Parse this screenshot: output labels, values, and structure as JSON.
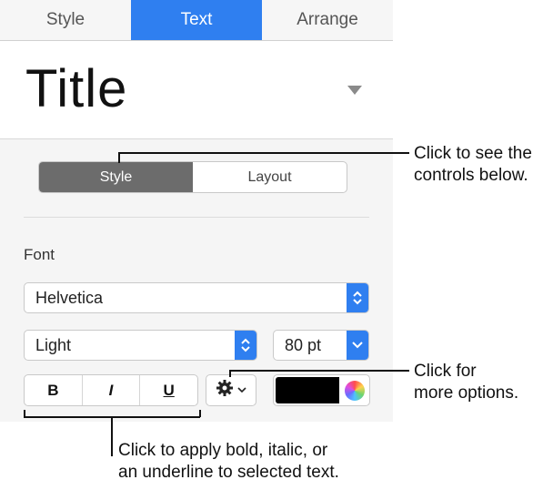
{
  "tabs": [
    {
      "label": "Style",
      "active": false
    },
    {
      "label": "Text",
      "active": true
    },
    {
      "label": "Arrange",
      "active": false
    }
  ],
  "paragraph_style": {
    "value": "Title"
  },
  "segment": [
    {
      "label": "Style",
      "selected": true
    },
    {
      "label": "Layout",
      "selected": false
    }
  ],
  "font": {
    "section_label": "Font",
    "family": "Helvetica",
    "typeface": "Light",
    "size": "80 pt"
  },
  "format_buttons": {
    "bold": "B",
    "italic": "I",
    "underline": "U"
  },
  "text_color": "#000000",
  "accent_color": "#2f7ff0",
  "icons": {
    "gear": "gear-icon",
    "chevron": "chevron-down-icon",
    "color_wheel": "color-wheel-icon"
  },
  "callouts": {
    "segment": [
      "Click to see the",
      "controls below."
    ],
    "gear": [
      "Click for",
      "more options."
    ],
    "format": [
      "Click to apply bold, italic, or",
      "an underline to selected text."
    ]
  }
}
